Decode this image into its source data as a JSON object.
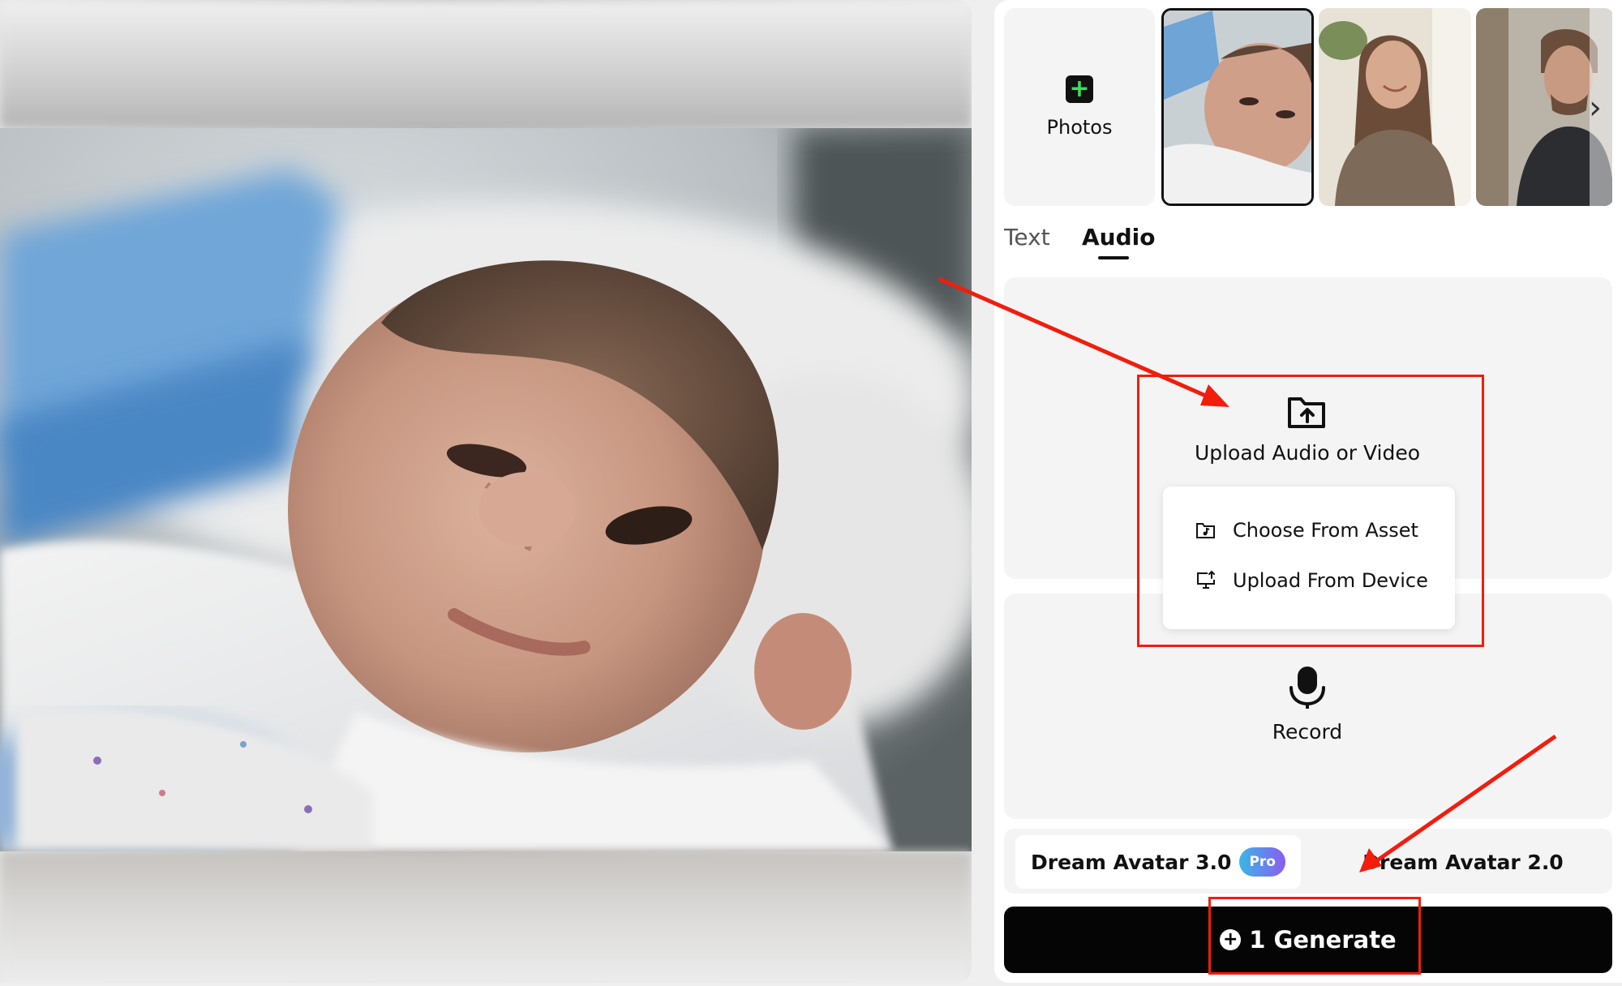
{
  "thumbnails": {
    "photos_label": "Photos",
    "items": [
      "baby",
      "woman",
      "man"
    ]
  },
  "tabs": [
    {
      "label": "Text",
      "active": false
    },
    {
      "label": "Audio",
      "active": true
    }
  ],
  "upload": {
    "label": "Upload Audio or Video",
    "menu": [
      {
        "label": "Choose From Asset",
        "icon": "folder-music-icon"
      },
      {
        "label": "Upload From Device",
        "icon": "monitor-upload-icon"
      }
    ]
  },
  "record": {
    "label": "Record",
    "icon": "microphone-icon"
  },
  "models": [
    {
      "label": "Dream Avatar 3.0",
      "badge": "Pro",
      "selected": true
    },
    {
      "label": "Dream Avatar 2.0",
      "selected": false
    }
  ],
  "generate": {
    "count": "1",
    "label": "Generate",
    "full_label": "1 Generate"
  },
  "colors": {
    "highlight": "#f21d0d",
    "generate_bg": "#050505",
    "plus_icon": "#39e05c",
    "pro_gradient": [
      "#3ab6e8",
      "#8a5cf0"
    ]
  }
}
